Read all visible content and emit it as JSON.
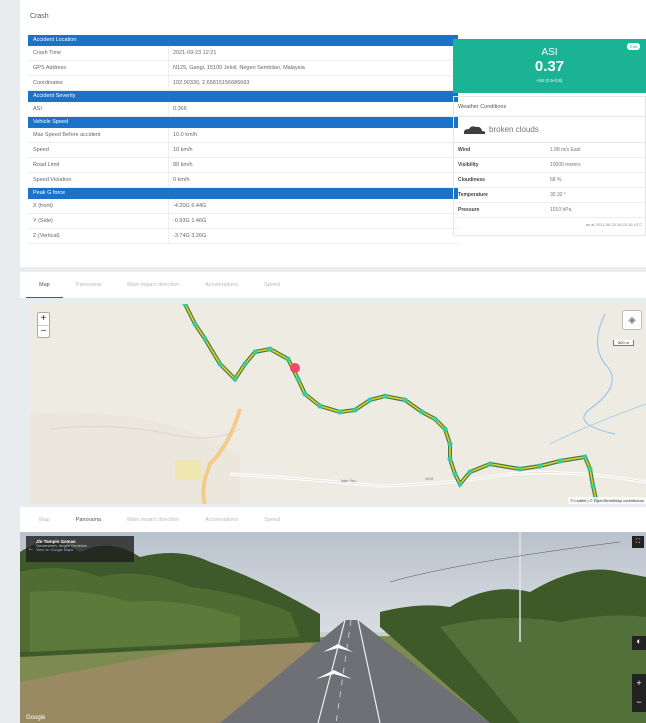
{
  "page": {
    "title": "Crash"
  },
  "details": {
    "sections": [
      {
        "title": "Accident Location",
        "rows": [
          {
            "label": "Crash Time",
            "value": "2021-09-23 12:21"
          },
          {
            "label": "GPS Address",
            "value": "N125, Gangi, 15100 Jeloil, Negeri Sembilan, Malaysia"
          },
          {
            "label": "Coordinates",
            "value": "102.90330, 2.65815156686663"
          }
        ]
      },
      {
        "title": "Accident Severity",
        "rows": [
          {
            "label": "ASI",
            "value": "0.366"
          }
        ]
      },
      {
        "title": "Vehicle Speed",
        "rows": [
          {
            "label": "Max Speed Before accident",
            "value": "10.0 km/h"
          },
          {
            "label": "Speed",
            "value": "10 km/h"
          },
          {
            "label": "Road Limit",
            "value": "80 km/h"
          },
          {
            "label": "Speed Violation",
            "value": "0 km/h"
          }
        ]
      },
      {
        "title": "Peak G force",
        "rows": [
          {
            "label": "X (front)",
            "value": "-4.20G   6.44G"
          },
          {
            "label": "Y (Side)",
            "value": "-0.93G   1.46G"
          },
          {
            "label": "Z (Vertical)",
            "value": "-3.74G   3.26G"
          }
        ]
      }
    ]
  },
  "asi": {
    "label": "ASI",
    "value": "0.37",
    "sub": "ASI (0.5-0.8)",
    "badge": "Edit"
  },
  "weather": {
    "title": "Weather Conditions",
    "description": "broken clouds",
    "icon": "cloud-icon",
    "rows": [
      {
        "label": "Wind",
        "value": "1.88 m/s East"
      },
      {
        "label": "Visibility",
        "value": "10000 meters"
      },
      {
        "label": "Cloudiness",
        "value": "68 %"
      },
      {
        "label": "Temperature",
        "value": "30.32 °"
      },
      {
        "label": "Pressure",
        "value": "1010 hPa"
      }
    ],
    "footer": "as at 2021-09-23 04:22:16 UTC"
  },
  "tabs_top": {
    "map": "Map",
    "panorama": "Panorama",
    "impact": "Main impact direction",
    "accel": "Accelerations",
    "speed": "Speed"
  },
  "tabs_bottom": {
    "map": "Map",
    "panorama": "Panorama",
    "impact": "Main impact direction",
    "accel": "Accelerations",
    "speed": "Speed"
  },
  "map": {
    "zoom_in": "+",
    "zoom_out": "−",
    "scale": "500 m",
    "attribution": "© Leaflet | © OpenStreetMap contributors",
    "route_color": "#e6d21c",
    "marker_color": "#f0486b",
    "point_color": "#2ad0a8",
    "road_label_1": "Jalan Sep...",
    "road_label_2": "N125"
  },
  "street_view": {
    "title": "Jln Tampin Gemas",
    "line1": "Gemencheh, Negeri Sembilan",
    "link": "View on Google Maps",
    "brand": "Google"
  }
}
